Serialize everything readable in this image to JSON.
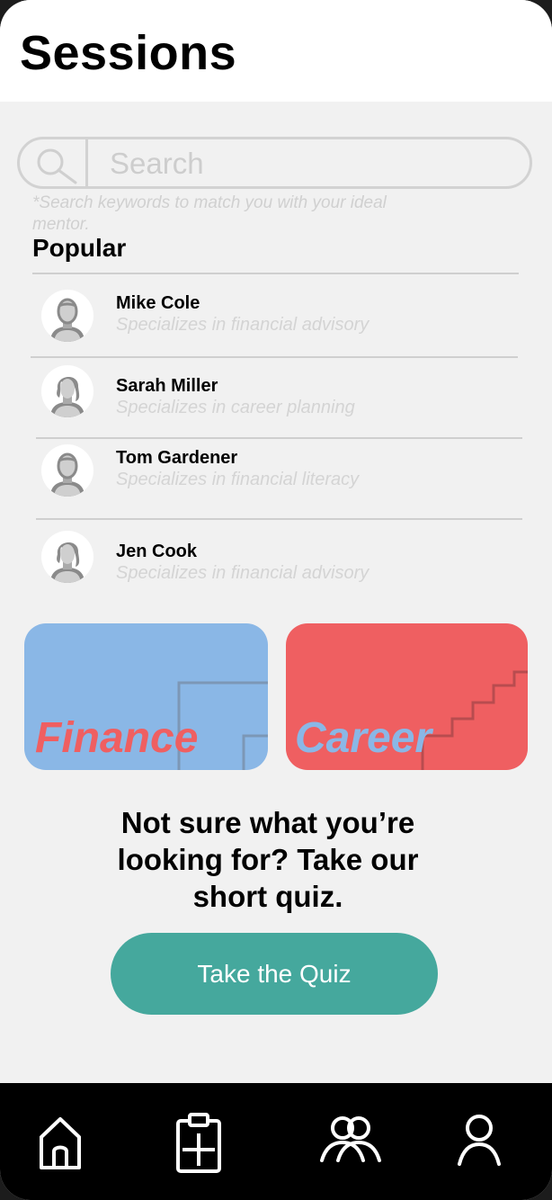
{
  "header": {
    "title": "Sessions"
  },
  "search": {
    "placeholder": "Search",
    "value": "",
    "hint": "*Search keywords to match you with your ideal mentor."
  },
  "popular": {
    "title": "Popular",
    "mentors": [
      {
        "name": "Mike Cole",
        "specialty": "Specializes in financial advisory",
        "avatar": "male-avatar-icon"
      },
      {
        "name": "Sarah Miller",
        "specialty": "Specializes in career planning",
        "avatar": "female-avatar-icon"
      },
      {
        "name": "Tom Gardener",
        "specialty": "Specializes in financial literacy",
        "avatar": "male-avatar-icon"
      },
      {
        "name": "Jen Cook",
        "specialty": "Specializes in financial advisory",
        "avatar": "female-avatar-icon"
      }
    ]
  },
  "categories": [
    {
      "label": "Finance",
      "background": "#8ab7e6",
      "text_color": "#ef5f61"
    },
    {
      "label": "Career",
      "background": "#ef5f61",
      "text_color": "#8ab7e6"
    }
  ],
  "quiz": {
    "prompt": "Not sure what you’re looking for? Take our short quiz.",
    "button_label": "Take the Quiz",
    "button_color": "#45a89d"
  },
  "nav": {
    "items": [
      {
        "name": "home",
        "icon": "home-icon"
      },
      {
        "name": "add-session",
        "icon": "clipboard-plus-icon"
      },
      {
        "name": "community",
        "icon": "group-icon"
      },
      {
        "name": "profile",
        "icon": "profile-icon"
      }
    ]
  }
}
